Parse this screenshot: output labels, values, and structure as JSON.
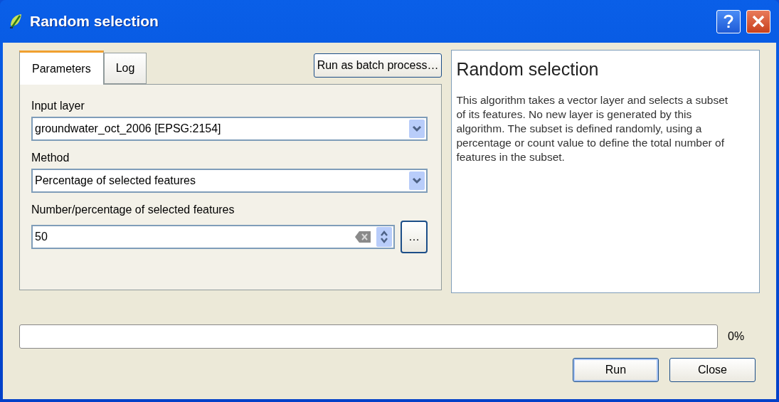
{
  "window": {
    "title": "Random selection"
  },
  "tabs": [
    {
      "label": "Parameters",
      "selected": true
    },
    {
      "label": "Log",
      "selected": false
    }
  ],
  "batch_button": "Run as batch process…",
  "fields": [
    {
      "kind": "combo",
      "label": "Input layer",
      "value": "groundwater_oct_2006 [EPSG:2154]"
    },
    {
      "kind": "combo",
      "label": "Method",
      "value": "Percentage of selected features"
    },
    {
      "kind": "spin",
      "label": "Number/percentage of selected features",
      "value": "50",
      "more_button": "…"
    }
  ],
  "help": {
    "title": "Random selection",
    "text": "This algorithm takes a vector layer and selects a subset of its features. No new layer is generated by this algorithm. The subset is defined randomly, using a percentage or count value to define the total number of features in the subset."
  },
  "progress": {
    "level": 0,
    "reading": "0%"
  },
  "buttons": [
    {
      "label": "Run",
      "default": true
    },
    {
      "label": "Close",
      "default": false
    }
  ]
}
